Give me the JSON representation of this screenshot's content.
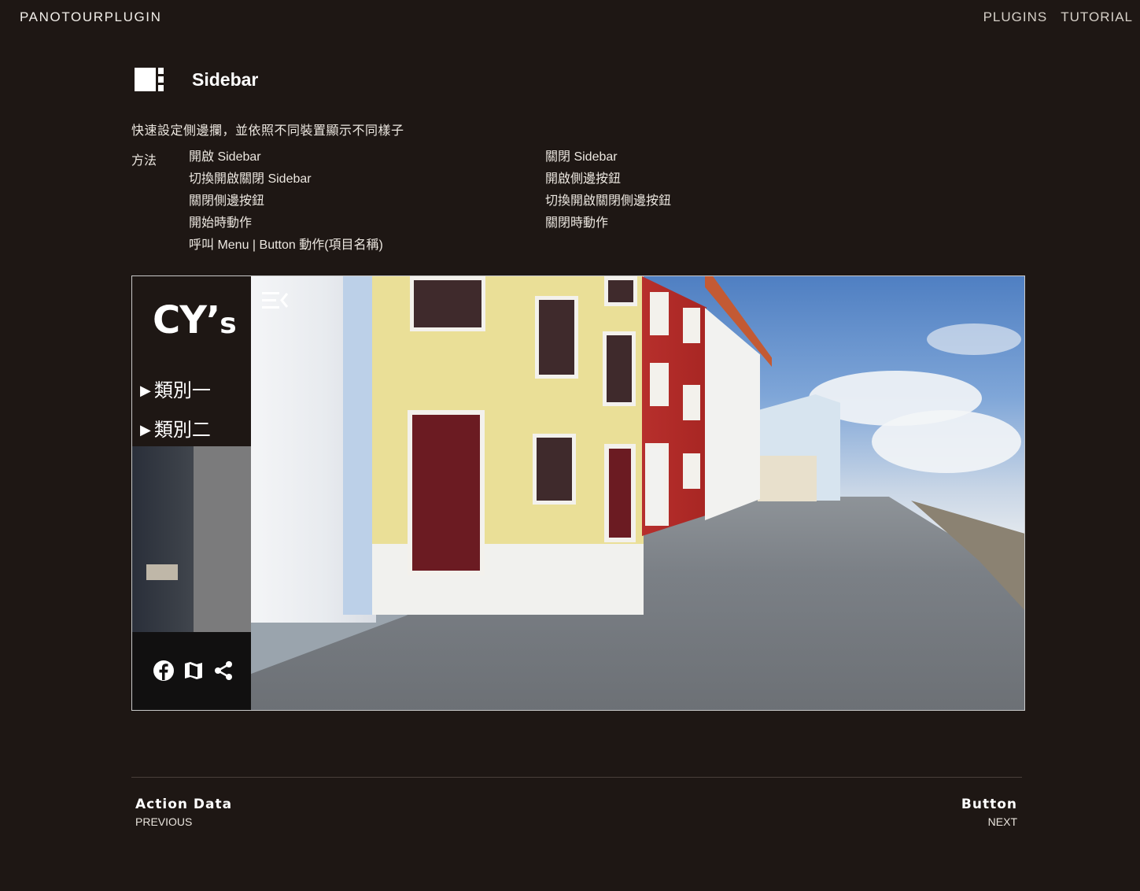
{
  "header": {
    "brand": "PANOTOURPLUGIN",
    "nav": [
      "PLUGINS",
      "TUTORIAL"
    ]
  },
  "page": {
    "title": "Sidebar",
    "description": "快速設定側邊攔，並依照不同裝置顯示不同樣子",
    "methods_label": "方法",
    "methods": [
      "開啟 Sidebar",
      "關閉 Sidebar",
      "切換開啟關閉 Sidebar",
      "開啟側邊按鈕",
      "關閉側邊按鈕",
      "切換開啟關閉側邊按鈕",
      "開始時動作",
      "關閉時動作",
      "呼叫 Menu | Button 動作(項目名稱)"
    ]
  },
  "demo": {
    "logo_main": "CY’",
    "logo_suffix": "s",
    "categories": [
      "類別一",
      "類別二"
    ],
    "category_marker": "▶",
    "social_icons": [
      "facebook-icon",
      "map-icon",
      "share-icon"
    ],
    "toggle_icon": "menu-collapse-icon"
  },
  "footer": {
    "previous": {
      "title": "Action Data",
      "label": "PREVIOUS"
    },
    "next": {
      "title": "Button",
      "label": "NEXT"
    }
  }
}
